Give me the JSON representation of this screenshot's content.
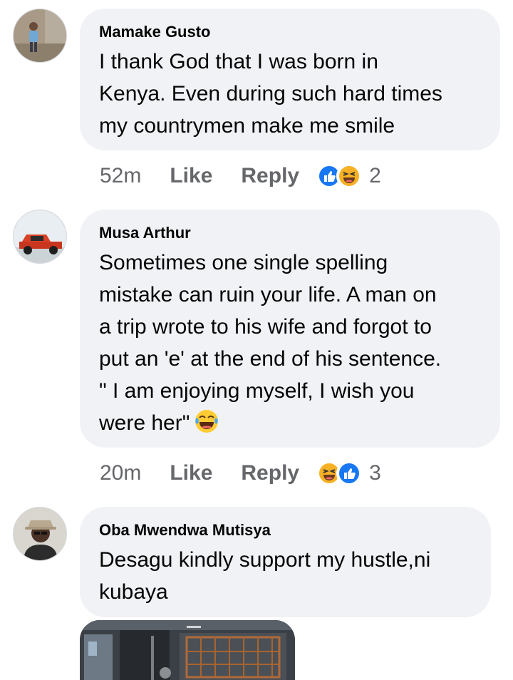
{
  "comments": [
    {
      "author": "Mamake Gusto",
      "text": "I thank God that I was born in\nKenya. Even during such hard times\nmy countrymen make me smile",
      "time": "52m",
      "like_label": "Like",
      "reply_label": "Reply",
      "reactions": [
        "like-reaction-icon",
        "haha-reaction-icon"
      ],
      "reaction_count": "2"
    },
    {
      "author": "Musa Arthur",
      "text": "Sometimes one single spelling\nmistake can ruin your life. A man on\na trip wrote to his wife and forgot to\nput an 'e' at the end of his sentence.\n\" I am enjoying myself, I wish you\nwere her\"",
      "inline_emoji": "tears-of-joy-emoji",
      "time": "20m",
      "like_label": "Like",
      "reply_label": "Reply",
      "reactions": [
        "haha-reaction-icon",
        "like-reaction-icon"
      ],
      "reaction_count": "3"
    },
    {
      "author": "Oba Mwendwa Mutisya",
      "text": "Desagu kindly support my hustle,ni\nkubaya",
      "attachment": "photo-attachment"
    }
  ],
  "colors": {
    "bubble": "#f0f2f5",
    "text": "#050505",
    "meta": "#65676b",
    "like_blue": "#1877f2",
    "haha_yellow": "#f7b125"
  }
}
